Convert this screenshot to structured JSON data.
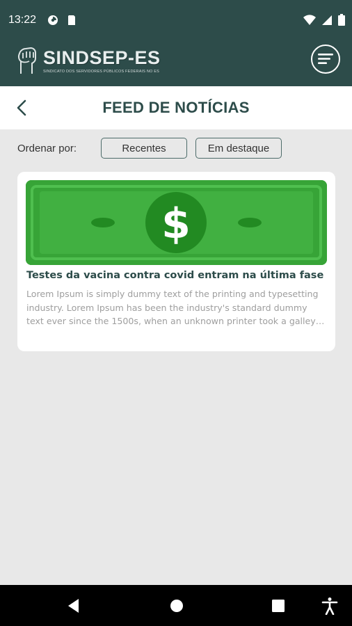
{
  "status_bar": {
    "time": "13:22",
    "icons_left": [
      "data-saver-icon",
      "sd-card-icon"
    ],
    "icons_right": [
      "wifi-icon",
      "signal-icon",
      "battery-icon"
    ]
  },
  "header": {
    "logo_title": "SINDSEP-ES",
    "logo_subtitle": "SINDICATO DOS SERVIDORES PÚBLICOS FEDERAIS NO ES",
    "menu_icon": "menu-icon"
  },
  "page": {
    "title": "FEED DE NOTÍCIAS"
  },
  "sort": {
    "label": "Ordenar por:",
    "options": [
      "Recentes",
      "Em destaque"
    ]
  },
  "news": [
    {
      "title": "Testes da vacina contra covid entram na última fase",
      "excerpt": "Lorem Ipsum is simply dummy text of the printing and typesetting industry. Lorem Ipsum has been the industry's standard dummy text ever since the 1500s, when an unknown printer took a galley…",
      "image_icon": "dollar-bill-icon"
    }
  ],
  "colors": {
    "primary": "#2d4c4a",
    "background": "#e8e8e8",
    "card": "#ffffff",
    "image_green": "#37a437"
  }
}
